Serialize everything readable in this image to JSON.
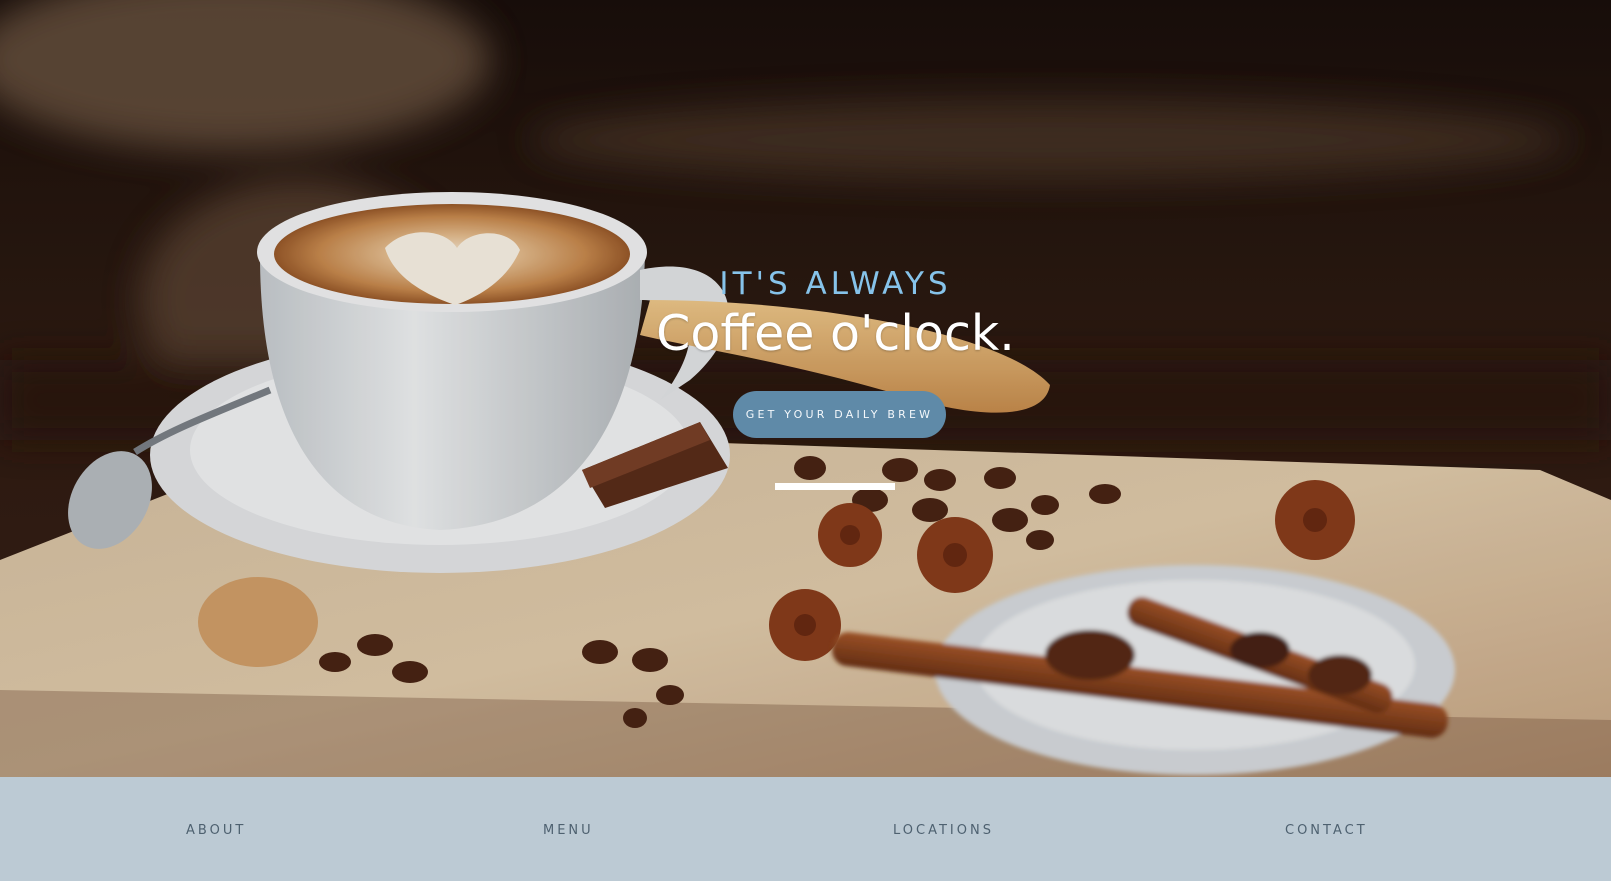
{
  "hero": {
    "eyebrow": "IT'S ALWAYS",
    "headline": "Coffee o'clock.",
    "cta_label": "GET YOUR DAILY BREW",
    "image": "coffee-latte-art-photo"
  },
  "nav": {
    "items": [
      {
        "label": "ABOUT"
      },
      {
        "label": "MENU"
      },
      {
        "label": "LOCATIONS"
      },
      {
        "label": "CONTACT"
      }
    ]
  },
  "colors": {
    "accent_light_blue": "#86c3ea",
    "button_blue": "#5f8aa8",
    "nav_background": "#bccad4",
    "nav_text": "#4e6170"
  }
}
